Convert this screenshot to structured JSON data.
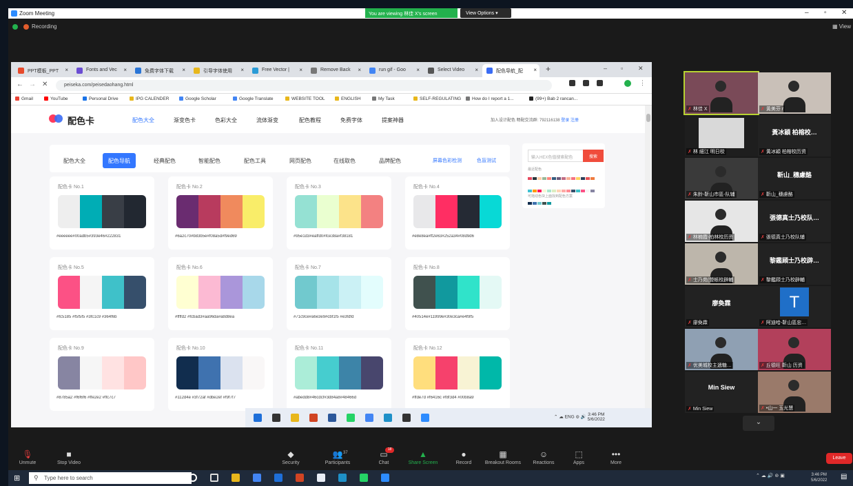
{
  "zoom": {
    "title": "Zoom Meeting",
    "share_status": "You are viewing 林佳 X's screen",
    "view_options": "View Options",
    "recording": "Recording",
    "view": "View"
  },
  "browser": {
    "tabs": [
      {
        "label": "PPT模板_PPT",
        "color": "#e74a2b"
      },
      {
        "label": "Fonts and Vec",
        "color": "#6b4dd3"
      },
      {
        "label": "免费字体下载",
        "color": "#2a75d6"
      },
      {
        "label": "引导字体使用",
        "color": "#e8b71c"
      },
      {
        "label": "Free Vector |",
        "color": "#2a9bd6"
      },
      {
        "label": "Remove Back",
        "color": "#777777"
      },
      {
        "label": "run gif - Goo",
        "color": "#4285f4"
      },
      {
        "label": "Select Video",
        "color": "#555555"
      },
      {
        "label": "配色导航_配",
        "color": "#3a6cf4"
      }
    ],
    "url": "peiseka.com/peisedaohang.html",
    "bookmarks": [
      {
        "label": "Gmail",
        "color": "#ea4335"
      },
      {
        "label": "YouTube",
        "color": "#ff0000"
      },
      {
        "label": "Personal Drive",
        "color": "#1a73e8"
      },
      {
        "label": "IPG CALENDER",
        "color": "#e8b71c"
      },
      {
        "label": "Google Scholar",
        "color": "#4285f4"
      },
      {
        "label": "Google Translate",
        "color": "#4285f4"
      },
      {
        "label": "WEBSITE TOOL",
        "color": "#e8b71c"
      },
      {
        "label": "ENGLISH",
        "color": "#e8b71c"
      },
      {
        "label": "My Task",
        "color": "#777777"
      },
      {
        "label": "SELF-REGULATING",
        "color": "#e8b71c"
      },
      {
        "label": "How do I report a 1...",
        "color": "#777777"
      },
      {
        "label": "(99+) Bab 2 rancan...",
        "color": "#222222"
      }
    ]
  },
  "site": {
    "logo": "配色卡",
    "nav": [
      "配色大全",
      "渐变色卡",
      "色彩大全",
      "流体渐变",
      "配色教程",
      "免费字体",
      "提案神器"
    ],
    "header_right": "加入设计配色 畅配交流群: 792116138",
    "login": "登录",
    "register": "注册",
    "subnav": [
      "配色大全",
      "配色导航",
      "经典配色",
      "智能配色",
      "配色工具",
      "网页配色",
      "在线取色",
      "品牌配色"
    ],
    "subnav_right": [
      "屏幕色彩检测",
      "色盲测试"
    ],
    "search": {
      "placeholder": "输入HEX色值搜索配色",
      "button": "搜索",
      "label": "最近配色",
      "tip": "可拖动色块上面找到配色方案"
    },
    "cards": [
      {
        "label": "配色卡 No.1",
        "hex": "#eeeeee#00adb5#393e46#222831",
        "colors": [
          "#eeeeee",
          "#00adb5",
          "#393e46",
          "#222831"
        ]
      },
      {
        "label": "配色卡 No.2",
        "hex": "#6a2c70#b83b5e#f08a5d#f9ed69",
        "colors": [
          "#6a2c70",
          "#b83b5e",
          "#f08a5d",
          "#f9ed69"
        ]
      },
      {
        "label": "配色卡 No.3",
        "hex": "#95e1d3#eaffd0#fce38a#f38181",
        "colors": [
          "#95e1d3",
          "#eaffd0",
          "#fce38a",
          "#f38181"
        ]
      },
      {
        "label": "配色卡 No.4",
        "hex": "#e8e8ea#ff2e63#252a34#08d9d6",
        "colors": [
          "#e8e8ea",
          "#ff2e63",
          "#252a34",
          "#08d9d6"
        ]
      },
      {
        "label": "配色卡 No.5",
        "hex": "#fc5185 #f5f5f5 #3fc1c9 #364f6b",
        "colors": [
          "#fc5185",
          "#f5f5f5",
          "#3fc1c9",
          "#364f6b"
        ]
      },
      {
        "label": "配色卡 No.6",
        "hex": "#ffffd2 #fcbad3#aa96da#a8d8ea",
        "colors": [
          "#ffffd2",
          "#fcbad3",
          "#aa96da",
          "#a8d8ea"
        ]
      },
      {
        "label": "配色卡 No.7",
        "hex": "#71c9ce#a6e3e9#cbf1f5 #e3fdfd",
        "colors": [
          "#71c9ce",
          "#a6e3e9",
          "#cbf1f5",
          "#e3fdfd"
        ]
      },
      {
        "label": "配色卡 No.8",
        "hex": "#40514e#11999e#30e3ca#e4f9f5",
        "colors": [
          "#40514e",
          "#11999e",
          "#30e3ca",
          "#e4f9f5"
        ]
      },
      {
        "label": "配色卡 No.9",
        "hex": "#8785a2 #f6f6f6 #ffe2e2 #ffc7c7",
        "colors": [
          "#8785a2",
          "#f6f6f6",
          "#ffe2e2",
          "#ffc7c7"
        ]
      },
      {
        "label": "配色卡 No.10",
        "hex": "#112d4e #3f72af #dbe2ef #f9f7f7",
        "colors": [
          "#112d4e",
          "#3f72af",
          "#dbe2ef",
          "#f9f7f7"
        ]
      },
      {
        "label": "配色卡 No.11",
        "hex": "#abedd8#46cdcf#3d84a8#48466d",
        "colors": [
          "#abedd8",
          "#46cdcf",
          "#3d84a8",
          "#48466d"
        ]
      },
      {
        "label": "配色卡 No.12",
        "hex": "#ffde7d #f6416c #f8f3d4 #00b8a9",
        "colors": [
          "#ffde7d",
          "#f6416c",
          "#f8f3d4",
          "#00b8a9"
        ]
      }
    ]
  },
  "inner_taskbar": {
    "lang": "ENG",
    "time": "3:46 PM",
    "date": "5/6/2022"
  },
  "participants": [
    {
      "name": "林佳 X",
      "type": "photo",
      "bg": "#7a4a58"
    },
    {
      "name": "黃美芬 r",
      "type": "photo",
      "bg": "#c9c0b8"
    },
    {
      "name": "林 細江 明日校",
      "type": "blank",
      "bg": "#1e1e1e"
    },
    {
      "name": "黃冰穎 柏榕校历资",
      "type": "text",
      "big": "黃冰穎 柏榕校…"
    },
    {
      "name": "朱鈴-靳山市區-队辅",
      "type": "photo",
      "bg": "#3a3a3a"
    },
    {
      "name": "靳山_穗慮酪",
      "type": "text",
      "big": "靳山_穗慮酪"
    },
    {
      "name": "林楠霞-柏林校历资",
      "type": "photo",
      "bg": "#e6e6e6"
    },
    {
      "name": "張德真士乃校队辅",
      "type": "text",
      "big": "張德真士乃校队…"
    },
    {
      "name": "士乃苑(營帳校辟輔",
      "type": "photo",
      "bg": "#bdb6ab"
    },
    {
      "name": "黎鑑頋士乃校辟輔",
      "type": "text",
      "big": "黎鑑頋士乃校辟…"
    },
    {
      "name": "廖奐霖",
      "type": "text",
      "big": "廖奐霖"
    },
    {
      "name": "阿迪哈-靳山區忠…",
      "type": "avatar",
      "letter": "T"
    },
    {
      "name": "优美城校主遞糖…",
      "type": "photo",
      "bg": "#8fa0b3"
    },
    {
      "name": "丘德旺 靳山 历资",
      "type": "photo",
      "bg": "#b2405b"
    },
    {
      "name": "Min Siew",
      "type": "text",
      "big": "Min Siew"
    },
    {
      "name": "•山一 玉光慧",
      "type": "photo",
      "bg": "#9a7a6a"
    }
  ],
  "toolbar": [
    {
      "label": "Unmute",
      "icon": "mic-muted-icon",
      "glyph": "🎙"
    },
    {
      "label": "Stop Video",
      "icon": "video-icon",
      "glyph": "■"
    },
    {
      "label": "Security",
      "icon": "shield-icon",
      "glyph": "◆"
    },
    {
      "label": "Participants",
      "icon": "participants-icon",
      "glyph": "👥"
    },
    {
      "label": "Chat",
      "icon": "chat-icon",
      "glyph": "▭"
    },
    {
      "label": "Share Screen",
      "icon": "share-screen-icon",
      "glyph": "▲"
    },
    {
      "label": "Record",
      "icon": "record-icon",
      "glyph": "●"
    },
    {
      "label": "Breakout Rooms",
      "icon": "breakout-icon",
      "glyph": "▦"
    },
    {
      "label": "Reactions",
      "icon": "reactions-icon",
      "glyph": "☺"
    },
    {
      "label": "Apps",
      "icon": "apps-icon",
      "glyph": "⬚"
    },
    {
      "label": "More",
      "icon": "more-icon",
      "glyph": "•••"
    }
  ],
  "participants_count": "37",
  "chat_badge": "18",
  "leave": "Leave",
  "taskbar": {
    "search": "Type here to search",
    "time": "3:46 PM",
    "date": "5/6/2022"
  }
}
